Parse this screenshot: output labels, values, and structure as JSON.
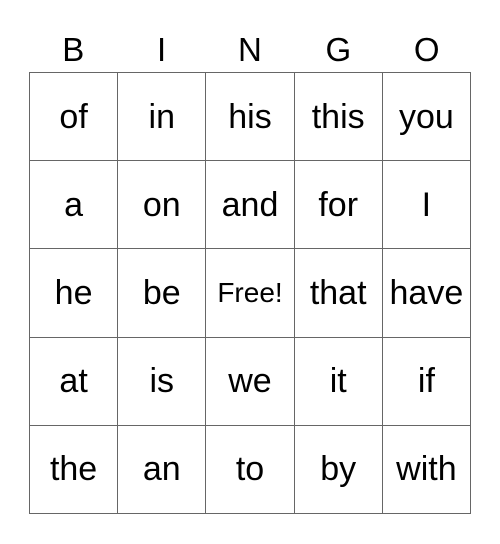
{
  "header": [
    "B",
    "I",
    "N",
    "G",
    "O"
  ],
  "rows": [
    [
      "of",
      "in",
      "his",
      "this",
      "you"
    ],
    [
      "a",
      "on",
      "and",
      "for",
      "I"
    ],
    [
      "he",
      "be",
      "Free!",
      "that",
      "have"
    ],
    [
      "at",
      "is",
      "we",
      "it",
      "if"
    ],
    [
      "the",
      "an",
      "to",
      "by",
      "with"
    ]
  ],
  "free_space": {
    "row": 2,
    "col": 2
  }
}
